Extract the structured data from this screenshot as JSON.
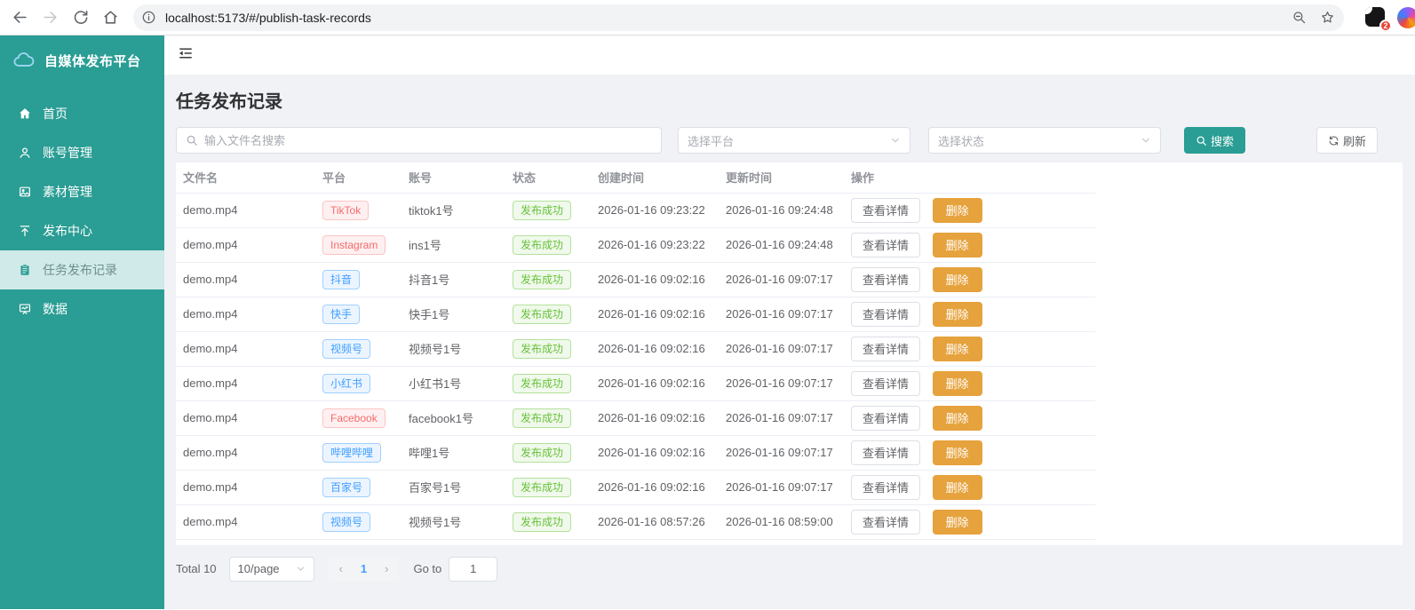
{
  "browser": {
    "url": "localhost:5173/#/publish-task-records",
    "extension_badge": "2"
  },
  "sidebar": {
    "logo_title": "自媒体发布平台",
    "items": [
      {
        "label": "首页",
        "icon": "home-icon",
        "active": false
      },
      {
        "label": "账号管理",
        "icon": "user-icon",
        "active": false
      },
      {
        "label": "素材管理",
        "icon": "image-icon",
        "active": false
      },
      {
        "label": "发布中心",
        "icon": "upload-icon",
        "active": false
      },
      {
        "label": "任务发布记录",
        "icon": "clipboard-icon",
        "active": true
      },
      {
        "label": "数据",
        "icon": "data-board-icon",
        "active": false
      }
    ]
  },
  "page": {
    "title": "任务发布记录",
    "filters": {
      "search_placeholder": "输入文件名搜索",
      "platform_placeholder": "选择平台",
      "status_placeholder": "选择状态",
      "search_button": "搜索",
      "refresh_button": "刷新"
    },
    "table": {
      "columns": [
        "文件名",
        "平台",
        "账号",
        "状态",
        "创建时间",
        "更新时间",
        "操作"
      ],
      "view_button": "查看详情",
      "delete_button": "删除",
      "rows": [
        {
          "file": "demo.mp4",
          "platform": "TikTok",
          "platform_type": "danger",
          "account": "tiktok1号",
          "status": "发布成功",
          "created": "2026-01-16 09:23:22",
          "updated": "2026-01-16 09:24:48"
        },
        {
          "file": "demo.mp4",
          "platform": "Instagram",
          "platform_type": "danger",
          "account": "ins1号",
          "status": "发布成功",
          "created": "2026-01-16 09:23:22",
          "updated": "2026-01-16 09:24:48"
        },
        {
          "file": "demo.mp4",
          "platform": "抖音",
          "platform_type": "primary",
          "account": "抖音1号",
          "status": "发布成功",
          "created": "2026-01-16 09:02:16",
          "updated": "2026-01-16 09:07:17"
        },
        {
          "file": "demo.mp4",
          "platform": "快手",
          "platform_type": "primary",
          "account": "快手1号",
          "status": "发布成功",
          "created": "2026-01-16 09:02:16",
          "updated": "2026-01-16 09:07:17"
        },
        {
          "file": "demo.mp4",
          "platform": "视频号",
          "platform_type": "primary",
          "account": "视频号1号",
          "status": "发布成功",
          "created": "2026-01-16 09:02:16",
          "updated": "2026-01-16 09:07:17"
        },
        {
          "file": "demo.mp4",
          "platform": "小红书",
          "platform_type": "primary",
          "account": "小红书1号",
          "status": "发布成功",
          "created": "2026-01-16 09:02:16",
          "updated": "2026-01-16 09:07:17"
        },
        {
          "file": "demo.mp4",
          "platform": "Facebook",
          "platform_type": "danger",
          "account": "facebook1号",
          "status": "发布成功",
          "created": "2026-01-16 09:02:16",
          "updated": "2026-01-16 09:07:17"
        },
        {
          "file": "demo.mp4",
          "platform": "哔哩哔哩",
          "platform_type": "primary",
          "account": "哔哩1号",
          "status": "发布成功",
          "created": "2026-01-16 09:02:16",
          "updated": "2026-01-16 09:07:17"
        },
        {
          "file": "demo.mp4",
          "platform": "百家号",
          "platform_type": "primary",
          "account": "百家号1号",
          "status": "发布成功",
          "created": "2026-01-16 09:02:16",
          "updated": "2026-01-16 09:07:17"
        },
        {
          "file": "demo.mp4",
          "platform": "视频号",
          "platform_type": "primary",
          "account": "视频号1号",
          "status": "发布成功",
          "created": "2026-01-16 08:57:26",
          "updated": "2026-01-16 08:59:00"
        }
      ]
    },
    "pagination": {
      "total_label": "Total 10",
      "page_size": "10/page",
      "prev": "‹",
      "current_page": "1",
      "next": "›",
      "goto_label": "Go to",
      "goto_value": "1"
    }
  },
  "colors": {
    "brand_teal": "#2a9d94",
    "active_menu_bg": "#cfeae8",
    "primary_blue": "#409eff",
    "success_green": "#67c23a",
    "danger_red": "#f56c6c",
    "warning_orange": "#e6a23c",
    "page_bg": "#f0f2f5"
  }
}
